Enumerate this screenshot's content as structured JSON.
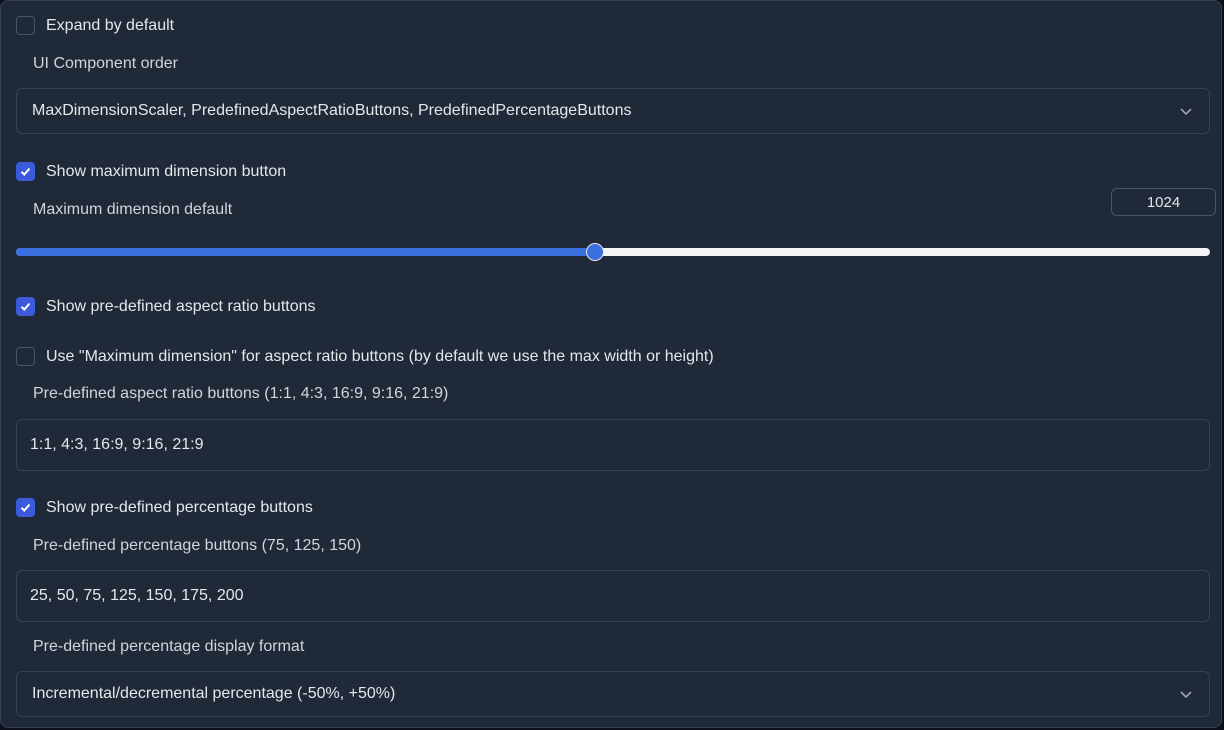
{
  "settings": {
    "expand_default": {
      "label": "Expand by default",
      "checked": false
    },
    "ui_order": {
      "label": "UI Component order",
      "value": "MaxDimensionScaler, PredefinedAspectRatioButtons, PredefinedPercentageButtons"
    },
    "show_max_dim": {
      "label": "Show maximum dimension button",
      "checked": true
    },
    "max_dim_default": {
      "label": "Maximum dimension default",
      "value": "1024",
      "slider_fraction": 0.485
    },
    "show_aspect": {
      "label": "Show pre-defined aspect ratio buttons",
      "checked": true
    },
    "use_max_dim": {
      "label": "Use \"Maximum dimension\" for aspect ratio buttons (by default we use the max width or height)",
      "checked": false
    },
    "aspect_buttons": {
      "label": "Pre-defined aspect ratio buttons (1:1, 4:3, 16:9, 9:16, 21:9)",
      "value": "1:1, 4:3, 16:9, 9:16, 21:9"
    },
    "show_percentage": {
      "label": "Show pre-defined percentage buttons",
      "checked": true
    },
    "percentage_buttons": {
      "label": "Pre-defined percentage buttons (75, 125, 150)",
      "value": "25, 50, 75, 125, 150, 175, 200"
    },
    "percentage_format": {
      "label": "Pre-defined percentage display format",
      "value": "Incremental/decremental percentage (-50%, +50%)"
    }
  },
  "colors": {
    "accent": "#3b6fe0",
    "panel_bg": "#1f2937",
    "border": "#374151"
  }
}
